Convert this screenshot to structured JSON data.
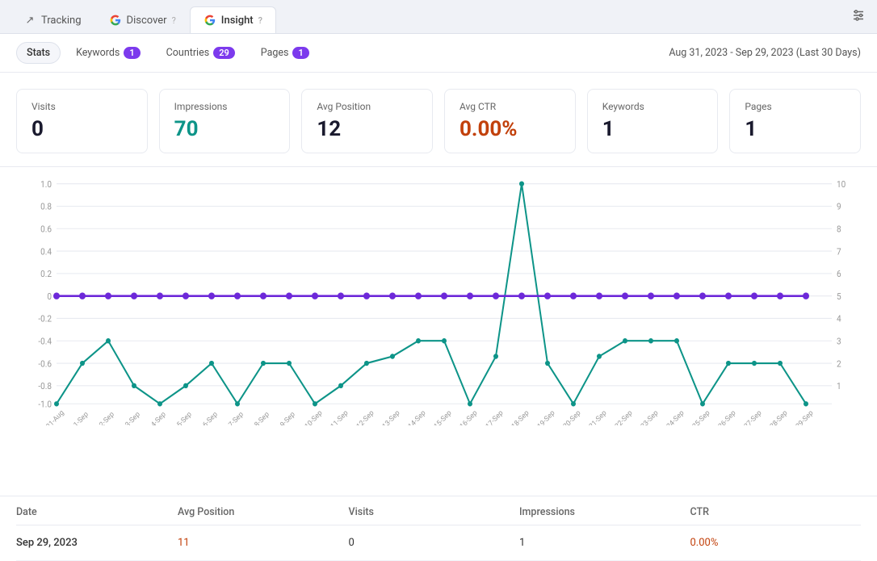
{
  "tabs": {
    "top": [
      {
        "id": "tracking",
        "label": "Tracking",
        "icon": "↗",
        "active": false
      },
      {
        "id": "discover",
        "label": "Discover",
        "icon": "G",
        "active": false
      },
      {
        "id": "insight",
        "label": "Insight",
        "icon": "G",
        "active": true
      }
    ],
    "sub": [
      {
        "id": "stats",
        "label": "Stats",
        "badge": null,
        "active": true
      },
      {
        "id": "keywords",
        "label": "Keywords",
        "badge": "1",
        "active": false
      },
      {
        "id": "countries",
        "label": "Countries",
        "badge": "29",
        "active": false
      },
      {
        "id": "pages",
        "label": "Pages",
        "badge": "1",
        "active": false
      }
    ]
  },
  "dateRange": "Aug 31, 2023  -  Sep 29, 2023  (Last 30 Days)",
  "stats": [
    {
      "label": "Visits",
      "value": "0",
      "colorClass": "dark"
    },
    {
      "label": "Impressions",
      "value": "70",
      "colorClass": "teal"
    },
    {
      "label": "Avg Position",
      "value": "12",
      "colorClass": "dark"
    },
    {
      "label": "Avg CTR",
      "value": "0.00%",
      "colorClass": "orange"
    },
    {
      "label": "Keywords",
      "value": "1",
      "colorClass": "dark"
    },
    {
      "label": "Pages",
      "value": "1",
      "colorClass": "dark"
    }
  ],
  "chart": {
    "leftAxis": [
      "1.0",
      "0.8",
      "0.6",
      "0.4",
      "0.2",
      "0",
      "-0.2",
      "-0.4",
      "-0.6",
      "-0.8",
      "-1.0"
    ],
    "rightAxis": [
      "10",
      "9",
      "8",
      "7",
      "6",
      "5",
      "4",
      "3",
      "2",
      "1"
    ],
    "xLabels": [
      "31-Aug",
      "1-Sep",
      "2-Sep",
      "3-Sep",
      "4-Sep",
      "5-Sep",
      "6-Sep",
      "7-Sep",
      "8-Sep",
      "9-Sep",
      "10-Sep",
      "11-Sep",
      "12-Sep",
      "13-Sep",
      "14-Sep",
      "15-Sep",
      "16-Sep",
      "17-Sep",
      "18-Sep",
      "19-Sep",
      "20-Sep",
      "21-Sep",
      "22-Sep",
      "23-Sep",
      "24-Sep",
      "25-Sep",
      "26-Sep",
      "27-Sep",
      "28-Sep",
      "29-Sep"
    ]
  },
  "table": {
    "headers": [
      "Date",
      "Avg Position",
      "Visits",
      "Impressions",
      "CTR"
    ],
    "rows": [
      {
        "date": "Sep 29, 2023",
        "avgPosition": "11",
        "visits": "0",
        "impressions": "1",
        "ctr": "0.00%"
      }
    ]
  },
  "settings_icon": "⊞"
}
